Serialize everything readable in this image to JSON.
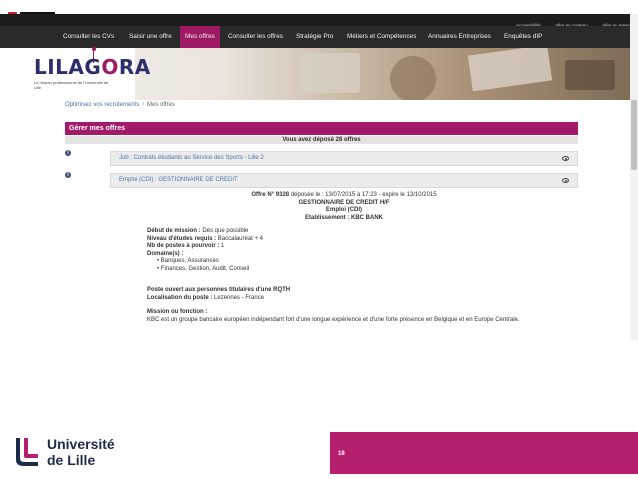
{
  "utility_links": [
    "Accessibilité",
    "Aller au contenu",
    "Aller au menu"
  ],
  "nav": {
    "items": [
      {
        "label": "Consulter les CVs"
      },
      {
        "label": "Saisir une offre"
      },
      {
        "label": "Mes offres"
      },
      {
        "label": "Consulter les offres"
      },
      {
        "label": "Stratégie Pro"
      },
      {
        "label": "Métiers et Compétences"
      },
      {
        "label": "Annuaires Entreprises"
      },
      {
        "label": "Enquêtes dIP"
      }
    ],
    "active_index": 2
  },
  "brand": {
    "logo_text_part1": "LILAG",
    "logo_text_o": "O",
    "logo_text_part2": "RA",
    "tagline": "Le réseau professionnel de l'Université de Lille"
  },
  "breadcrumb": {
    "link": "Optimisez vos recrutements",
    "separator": "/",
    "current": "Mes offres"
  },
  "manage": {
    "title": "Gérer mes offres",
    "count_text": "Vous avez déposé 28 offres"
  },
  "offers": [
    {
      "label": "Job : Contrats étudiants au Service des Sports - Lille 2"
    },
    {
      "label": "Emploi (CDI) : GESTIONNAIRE DE CREDIT"
    }
  ],
  "detail": {
    "offer_number": "Offre N° 9328",
    "deposit_info": "déposée le : 13/07/2015 à 17:23 - expire le 13/10/2015",
    "title": "GESTIONNAIRE DE CREDIT H/F",
    "contract": "Emploi (CDI)",
    "establishment": "Etablissement : KBC BANK",
    "start_label": "Début de mission :",
    "start_value": "Dès que possible",
    "level_label": "Niveau d'études requis :",
    "level_value": "Baccalauréat + 4",
    "positions_label": "Nb de postes à pourvoir :",
    "positions_value": "1",
    "domains_label": "Domaine(s) :",
    "domains": [
      "Banques, Assurances",
      "Finances, Gestion, Audit, Conseil"
    ],
    "open_to": "Poste ouvert aux personnes titulaires d'une RQTH",
    "location_label": "Localisation du poste :",
    "location_value": "Lezennes - France",
    "mission_label": "Mission ou fonction :",
    "mission_text": "KBC est un groupe bancaire européen indépendant fort d'une longue expérience et d'une forte présence en Belgique et en Europe Centrale."
  },
  "footer": {
    "university_line1": "Université",
    "university_line2": "de Lille",
    "page_number": "18"
  },
  "colors": {
    "accent": "#a31a6a",
    "nav_bg": "#2a2a2a",
    "footer_bar": "#b61e6e",
    "link": "#4a74a8"
  },
  "icons": [
    "browser-icon",
    "info-icon",
    "eye-icon",
    "university-logo-icon"
  ]
}
